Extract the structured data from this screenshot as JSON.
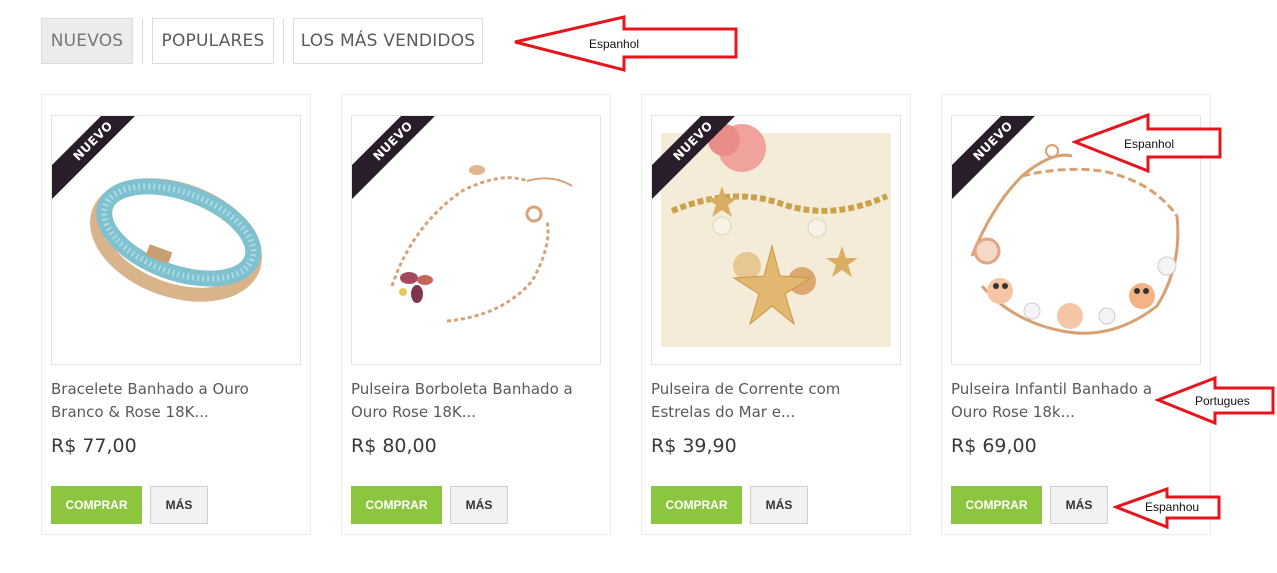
{
  "tabs": [
    {
      "label": "NUEVOS"
    },
    {
      "label": "POPULARES"
    },
    {
      "label": "LOS MÁS VENDIDOS"
    }
  ],
  "products": [
    {
      "badge": "NUEVO",
      "name_line1": "Bracelete Banhado a Ouro",
      "name_line2": "Branco & Rose 18K...",
      "price": "R$ 77,00",
      "buy_label": "COMPRAR",
      "more_label": "MÁS"
    },
    {
      "badge": "NUEVO",
      "name_line1": "Pulseira Borboleta Banhado a",
      "name_line2": "Ouro Rose 18K...",
      "price": "R$ 80,00",
      "buy_label": "COMPRAR",
      "more_label": "MÁS"
    },
    {
      "badge": "NUEVO",
      "name_line1": "Pulseira de Corrente com",
      "name_line2": "Estrelas do Mar e...",
      "price": "R$ 39,90",
      "buy_label": "COMPRAR",
      "more_label": "MÁS"
    },
    {
      "badge": "NUEVO",
      "name_line1": "Pulseira Infantil Banhado a",
      "name_line2": "Ouro Rose 18k...",
      "price": "R$ 69,00",
      "buy_label": "COMPRAR",
      "more_label": "MÁS"
    }
  ],
  "annotations": [
    {
      "label": "Espanhol"
    },
    {
      "label": "Espanhol"
    },
    {
      "label": "Portugues"
    },
    {
      "label": "Espanhou"
    }
  ],
  "colors": {
    "buy_button": "#8cc63e",
    "ribbon": "#2a1d2a",
    "annotation_arrow": "#e8141c"
  }
}
